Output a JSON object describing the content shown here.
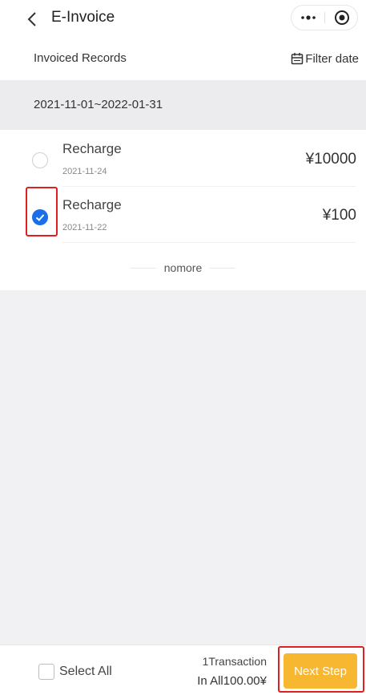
{
  "nav": {
    "title": "E-Invoice",
    "back_icon": "chevron-left-icon",
    "more_icon": "more-dots-icon",
    "target_icon": "record-target-icon"
  },
  "records": {
    "title": "Invoiced Records",
    "filter_label": "Filter date",
    "filter_icon": "calendar-icon"
  },
  "range": {
    "text": "2021-11-01~2022-01-31"
  },
  "items": [
    {
      "name": "Recharge",
      "date": "2021-11-24",
      "amount": "¥10000",
      "selected": false
    },
    {
      "name": "Recharge",
      "date": "2021-11-22",
      "amount": "¥100",
      "selected": true
    }
  ],
  "list_end_text": "nomore",
  "footer": {
    "select_all_label": "Select All",
    "transaction_count": "1Transaction",
    "total": "In All100.00¥",
    "next_label": "Next Step"
  },
  "colors": {
    "accent_blue": "#1a6fe8",
    "next_button": "#f7b731",
    "highlight_red": "#e02020"
  }
}
